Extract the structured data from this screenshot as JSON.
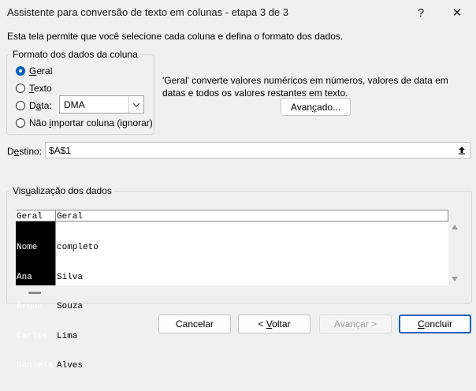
{
  "window": {
    "title": "Assistente para conversão de texto em colunas - etapa 3 de 3",
    "help_label": "?",
    "close_label": "✕"
  },
  "intro": "Esta tela permite que você selecione cada coluna e defina o formato dos dados.",
  "format_group": {
    "legend": "Formato dos dados da coluna",
    "options": [
      {
        "pre": "",
        "accel": "G",
        "post": "eral",
        "selected": true
      },
      {
        "pre": "",
        "accel": "T",
        "post": "exto",
        "selected": false
      },
      {
        "pre": "D",
        "accel": "a",
        "post": "ta:",
        "selected": false
      },
      {
        "pre": "Não ",
        "accel": "i",
        "post": "mportar coluna (ignorar)",
        "selected": false
      }
    ],
    "date_format": "DMA"
  },
  "description": "'Geral' converte valores numéricos em números, valores de data em datas e todos os valores restantes em texto.",
  "advanced_button": {
    "pre": "Avan",
    "accel": "ç",
    "post": "ado..."
  },
  "destination": {
    "pre": "D",
    "accel": "e",
    "post": "stino:",
    "value": "$A$1"
  },
  "preview_group": {
    "legend_pre": "Vis",
    "legend_accel": "u",
    "legend_post": "alização dos dados",
    "headers": [
      "Geral",
      "Geral"
    ],
    "col1": [
      "Nome",
      "Ana",
      "Bruno",
      "Carlos",
      "Daniela"
    ],
    "col2": [
      "completo",
      "Silva",
      "Souza",
      "Lima",
      "Alves"
    ]
  },
  "buttons": {
    "cancel": "Cancelar",
    "back_pre": "< ",
    "back_accel": "V",
    "back_post": "oltar",
    "next": "Avançar >",
    "finish_pre": "",
    "finish_accel": "C",
    "finish_post": "oncluir"
  },
  "colors": {
    "accent": "#005fb8",
    "window_bg": "#f0f0f0",
    "selected_col_bg": "#000000"
  }
}
